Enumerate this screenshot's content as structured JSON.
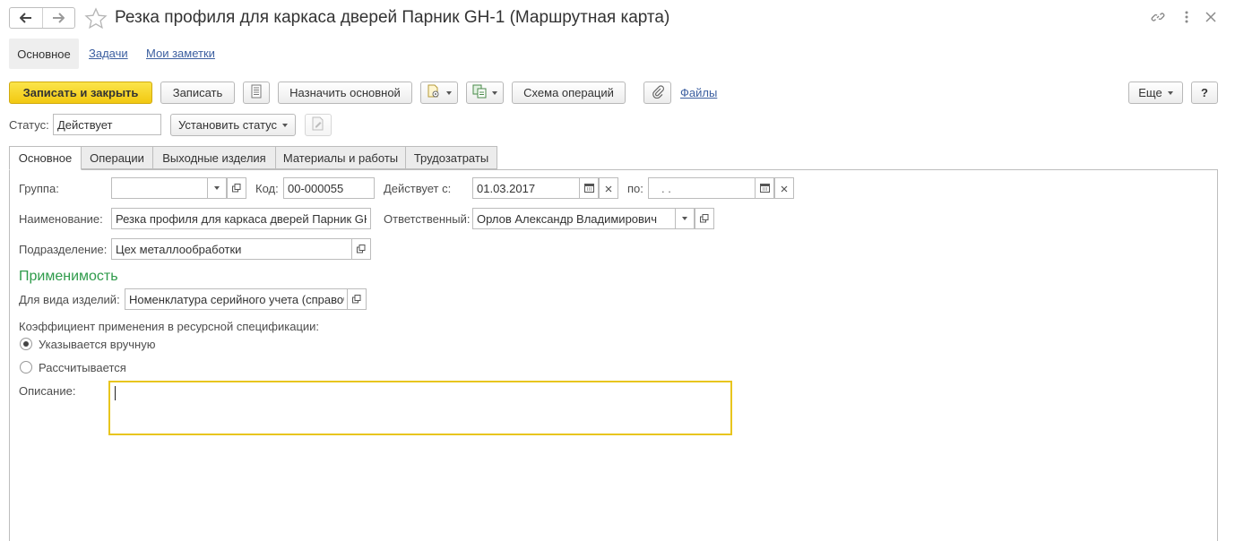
{
  "window": {
    "title": "Резка профиля для каркаса дверей Парник GH-1 (Маршрутная карта)",
    "icons": [
      "back-arrow-icon",
      "forward-arrow-icon",
      "star-icon",
      "link-icon",
      "more-vert-icon",
      "close-icon"
    ]
  },
  "sections": {
    "main": "Основное",
    "tasks": "Задачи",
    "notes": "Мои заметки"
  },
  "toolbar": {
    "save_close": "Записать и закрыть",
    "save": "Записать",
    "assign_main": "Назначить основной",
    "ops_scheme": "Схема операций",
    "files": "Файлы",
    "more": "Еще",
    "help": "?"
  },
  "status": {
    "label": "Статус:",
    "value": "Действует",
    "set_status": "Установить статус"
  },
  "tabs": [
    "Основное",
    "Операции",
    "Выходные изделия",
    "Материалы и работы",
    "Трудозатраты"
  ],
  "form": {
    "group_label": "Группа:",
    "group_value": "",
    "code_label": "Код:",
    "code_value": "00-000055",
    "valid_from_label": "Действует с:",
    "valid_from_value": "01.03.2017",
    "valid_to_label": "по:",
    "valid_to_value": " .  .",
    "name_label": "Наименование:",
    "name_value": "Резка профиля для каркаса дверей Парник GH",
    "responsible_label": "Ответственный:",
    "responsible_value": "Орлов Александр Владимирович",
    "department_label": "Подразделение:",
    "department_value": "Цех металлообработки",
    "applicability_title": "Применимость",
    "product_kind_label": "Для вида изделий:",
    "product_kind_value": "Номенклатура серийного учета (справоч",
    "coef_label": "Коэффициент применения в ресурсной спецификации:",
    "radio_manual": "Указывается вручную",
    "radio_calc": "Рассчитывается",
    "radio_selected": "manual",
    "description_label": "Описание:",
    "description_value": ""
  }
}
